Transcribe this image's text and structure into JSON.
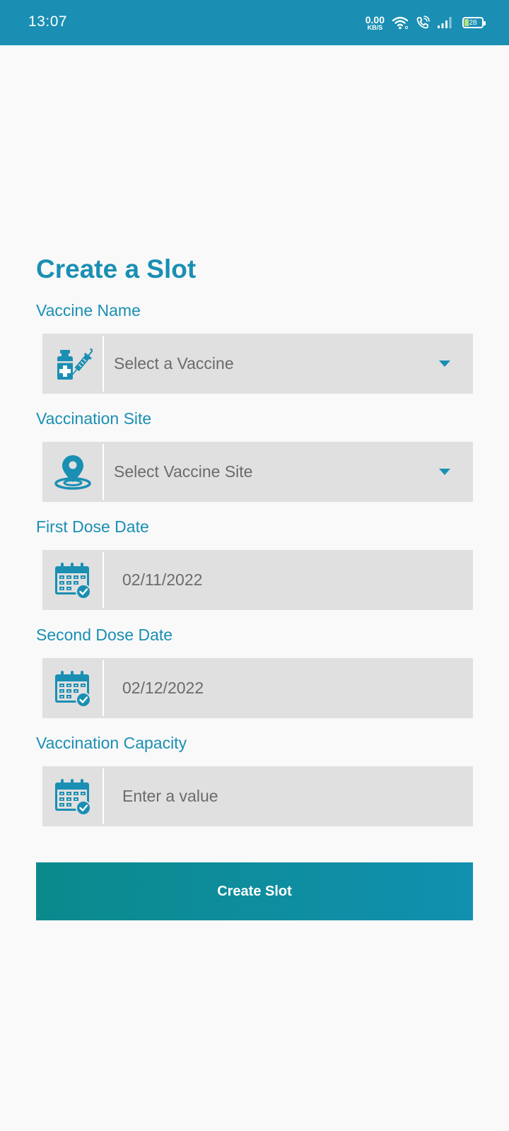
{
  "status_bar": {
    "time": "13:07",
    "net_speed_value": "0.00",
    "net_speed_unit": "KB/S",
    "battery_level": "28",
    "icons": [
      "wifi-icon",
      "wifi-call-icon",
      "signal-icon",
      "battery-icon"
    ]
  },
  "form": {
    "title": "Create a Slot",
    "vaccine_name": {
      "label": "Vaccine Name",
      "placeholder": "Select a Vaccine",
      "icon": "vaccine-icon"
    },
    "vaccination_site": {
      "label": "Vaccination Site",
      "placeholder": "Select Vaccine Site",
      "icon": "location-pin-icon"
    },
    "first_dose_date": {
      "label": "First Dose Date",
      "value": "02/11/2022",
      "icon": "calendar-check-icon"
    },
    "second_dose_date": {
      "label": "Second Dose Date",
      "value": "02/12/2022",
      "icon": "calendar-check-icon"
    },
    "vaccination_capacity": {
      "label": "Vaccination Capacity",
      "placeholder": "Enter a value",
      "icon": "calendar-check-icon"
    },
    "submit_label": "Create Slot"
  },
  "colors": {
    "accent": "#1a8fb3",
    "field_background": "#e0e0e0",
    "page_background": "#f9f9f9",
    "button_gradient_start": "#0b8a8c",
    "button_gradient_end": "#1190b0"
  }
}
